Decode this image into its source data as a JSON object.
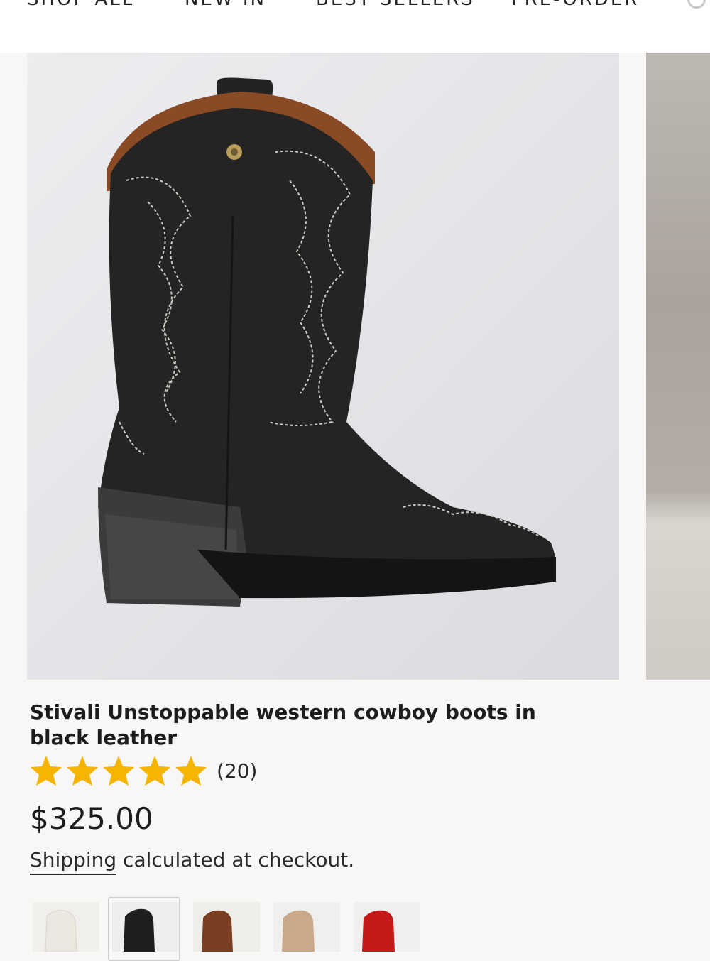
{
  "nav": {
    "items": [
      "SHOP ALL",
      "NEW IN",
      "BEST SELLERS",
      "PRE-ORDER"
    ]
  },
  "product": {
    "title": "Stivali Unstoppable western cowboy boots in black leather",
    "rating": 5,
    "rating_max": 5,
    "review_count": "(20)",
    "price": "$325.00",
    "shipping_link": "Shipping",
    "shipping_rest": " calculated at checkout."
  },
  "swatches": [
    {
      "color_name": "cream",
      "hex": "#ece8e0",
      "selected": false
    },
    {
      "color_name": "black",
      "hex": "#1e1e1e",
      "selected": true
    },
    {
      "color_name": "brown",
      "hex": "#7a3f22",
      "selected": false
    },
    {
      "color_name": "tan",
      "hex": "#c9a98a",
      "selected": false
    },
    {
      "color_name": "red",
      "hex": "#c41a1a",
      "selected": false
    }
  ],
  "colors": {
    "star": "#f5b400",
    "background": "#f8f7f5",
    "text": "#1d1d1d"
  }
}
